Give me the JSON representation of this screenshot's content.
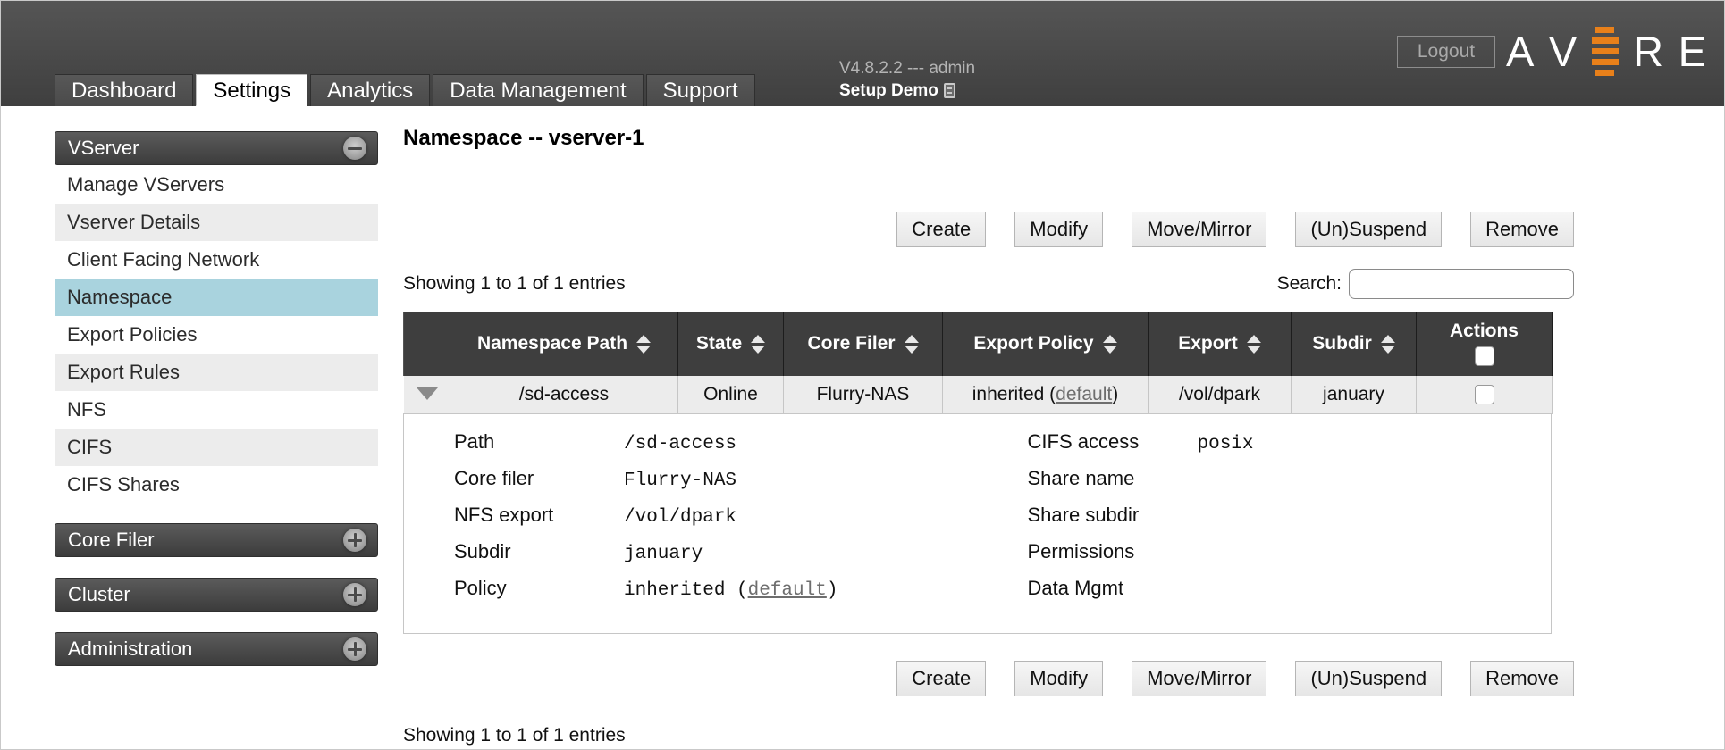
{
  "header": {
    "logout_label": "Logout",
    "brand_letters": [
      "A",
      "V",
      "E",
      "R",
      "E"
    ],
    "version_line": "V4.8.2.2 --- admin",
    "cluster_name": "Setup Demo",
    "accent_color": "#e8801a"
  },
  "tabs": [
    {
      "label": "Dashboard",
      "active": false
    },
    {
      "label": "Settings",
      "active": true
    },
    {
      "label": "Analytics",
      "active": false
    },
    {
      "label": "Data Management",
      "active": false
    },
    {
      "label": "Support",
      "active": false
    }
  ],
  "sidebar": {
    "sections": [
      {
        "title": "VServer",
        "expanded": true,
        "items": [
          {
            "label": "Manage VServers",
            "active": false
          },
          {
            "label": "Vserver Details",
            "active": false
          },
          {
            "label": "Client Facing Network",
            "active": false
          },
          {
            "label": "Namespace",
            "active": true
          },
          {
            "label": "Export Policies",
            "active": false
          },
          {
            "label": "Export Rules",
            "active": false
          },
          {
            "label": "NFS",
            "active": false
          },
          {
            "label": "CIFS",
            "active": false
          },
          {
            "label": "CIFS Shares",
            "active": false
          }
        ]
      },
      {
        "title": "Core Filer",
        "expanded": false,
        "items": []
      },
      {
        "title": "Cluster",
        "expanded": false,
        "items": []
      },
      {
        "title": "Administration",
        "expanded": false,
        "items": []
      }
    ],
    "highlight_color": "#a9d3de"
  },
  "main": {
    "page_title": "Namespace -- vserver-1",
    "buttons": [
      "Create",
      "Modify",
      "Move/Mirror",
      "(Un)Suspend",
      "Remove"
    ],
    "showing_text": "Showing 1 to 1 of 1 entries",
    "showing_text_bottom": "Showing 1 to 1 of 1 entries",
    "search": {
      "label": "Search:",
      "value": "",
      "placeholder": ""
    },
    "table": {
      "columns": [
        {
          "label": "",
          "sortable": false
        },
        {
          "label": "Namespace Path",
          "sortable": true
        },
        {
          "label": "State",
          "sortable": true
        },
        {
          "label": "Core Filer",
          "sortable": true
        },
        {
          "label": "Export Policy",
          "sortable": true
        },
        {
          "label": "Export",
          "sortable": true
        },
        {
          "label": "Subdir",
          "sortable": true
        },
        {
          "label": "Actions",
          "sortable": false
        }
      ],
      "header_select_all_checked": false,
      "rows": [
        {
          "expanded": true,
          "namespace_path": "/sd-access",
          "state": "Online",
          "core_filer": "Flurry-NAS",
          "export_policy_prefix": "inherited (",
          "export_policy_link": "default",
          "export_policy_suffix": ")",
          "export": "/vol/dpark",
          "subdir": "january",
          "selected": false
        }
      ]
    },
    "detail": {
      "left": [
        {
          "label": "Path",
          "value": "/sd-access"
        },
        {
          "label": "Core filer",
          "value": "Flurry-NAS"
        },
        {
          "label": "NFS export",
          "value": "/vol/dpark"
        },
        {
          "label": "Subdir",
          "value": "january"
        },
        {
          "label": "Policy",
          "value_prefix": "inherited (",
          "value_link": "default",
          "value_suffix": ")"
        }
      ],
      "right": [
        {
          "label": "CIFS access",
          "value": "posix"
        },
        {
          "label": "Share name",
          "value": ""
        },
        {
          "label": "Share subdir",
          "value": ""
        },
        {
          "label": "Permissions",
          "value": ""
        },
        {
          "label": "Data Mgmt",
          "value": ""
        }
      ]
    }
  }
}
